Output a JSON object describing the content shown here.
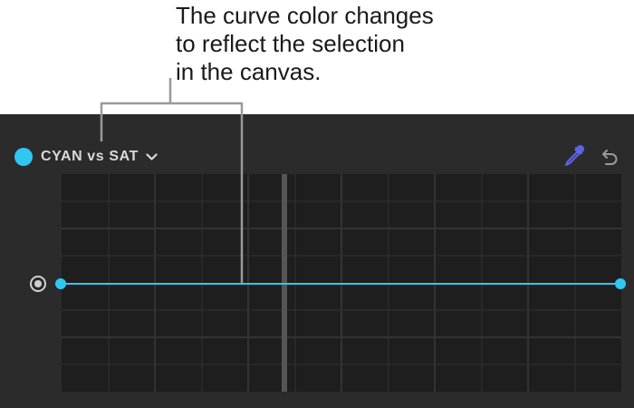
{
  "callout": {
    "lines": [
      "The curve color changes",
      "to reflect the selection",
      "in the canvas."
    ]
  },
  "header": {
    "title": "CYAN vs SAT",
    "swatch_color": "#30c7f2",
    "dropdown_icon": "chevron-down-icon"
  },
  "toolbar": {
    "eyedropper_icon": "eyedropper-icon",
    "eyedropper_color": "#5b63e8",
    "reset_icon": "undo-icon"
  },
  "curve": {
    "color": "#30c7f2",
    "start_point": {
      "x": 0,
      "y": 0.5
    },
    "end_point": {
      "x": 1,
      "y": 0.5
    }
  },
  "colors": {
    "panel_bg": "#2b2b2b",
    "grid_bg": "#1e1e1e",
    "grid_line": "#333333",
    "center_marker": "#555555"
  }
}
